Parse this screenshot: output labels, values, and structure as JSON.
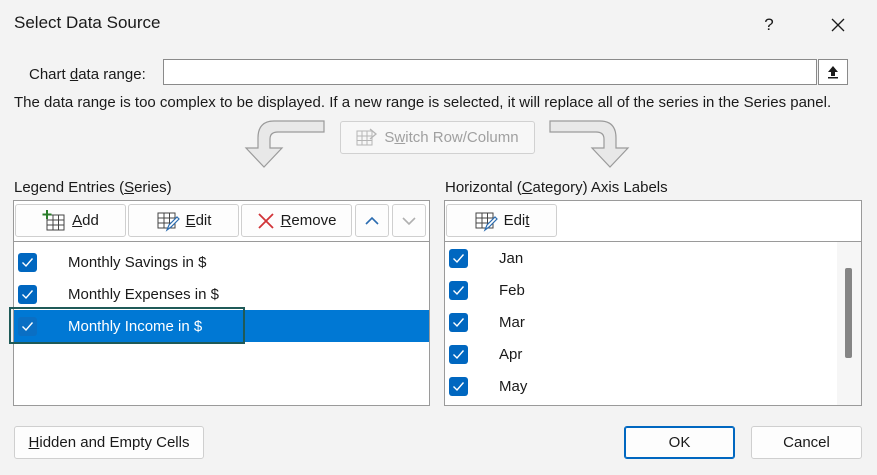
{
  "window": {
    "title": "Select Data Source",
    "help_label": "?",
    "icons": {
      "close": "close-icon",
      "collapse": "collapse-dialog-icon"
    }
  },
  "range": {
    "label_pre": "Chart ",
    "label_u": "d",
    "label_post": "ata range:",
    "value": ""
  },
  "note": "The data range is too complex to be displayed. If a new range is selected, it will replace all of the series in the Series panel.",
  "switch": {
    "pre": "S",
    "u": "w",
    "post": "itch Row/Column"
  },
  "legend": {
    "label_pre": "Legend Entries (",
    "label_u": "S",
    "label_post": "eries)",
    "add": {
      "u": "A",
      "post": "dd"
    },
    "edit": {
      "u": "E",
      "post": "dit"
    },
    "remove": {
      "u": "R",
      "post": "emove"
    },
    "series": [
      {
        "name": "Monthly Savings in $",
        "checked": true,
        "selected": false
      },
      {
        "name": "Monthly Expenses in $",
        "checked": true,
        "selected": false
      },
      {
        "name": "Monthly Income in $",
        "checked": true,
        "selected": true
      }
    ]
  },
  "axis": {
    "label_pre": "Horizontal (",
    "label_u": "C",
    "label_post": "ategory) Axis Labels",
    "edit": {
      "pre": "Edi",
      "u": "t",
      "post": ""
    },
    "items": [
      "Jan",
      "Feb",
      "Mar",
      "Apr",
      "May"
    ]
  },
  "footer": {
    "hidden": {
      "u": "H",
      "post": "idden and Empty Cells"
    },
    "ok": "OK",
    "cancel": "Cancel"
  },
  "colors": {
    "accent": "#0078d4",
    "check": "#0067c0",
    "focus": "#1f5a58"
  }
}
